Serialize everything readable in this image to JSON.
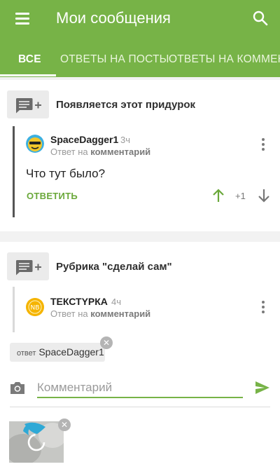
{
  "header": {
    "title": "Мои сообщения",
    "icons": {
      "menu": "hamburger-menu-icon",
      "search": "search-icon"
    }
  },
  "tabs": [
    {
      "label": "ВСЕ",
      "active": true
    },
    {
      "label": "ОТВЕТЫ НА ПОСТЫ",
      "active": false
    },
    {
      "label": "ОТВЕТЫ НА КОММЕНТАРИИ",
      "active": false
    }
  ],
  "posts": [
    {
      "title": "Появляется этот придурок",
      "comment": {
        "author": "SpaceDagger1",
        "time": "3ч",
        "reply_prefix": "Ответ на",
        "reply_target": "комментарий",
        "text": "Что тут было?",
        "reply_label": "ОТВЕТИТЬ",
        "rating": "+1"
      }
    },
    {
      "title": "Рубрика \"сделай сам\"",
      "comment": {
        "author": "ТЕКСТYРКА",
        "time": "4ч",
        "reply_prefix": "Ответ на",
        "reply_target": "комментарий",
        "avatar_text": "NB"
      }
    }
  ],
  "compose": {
    "reply_prefix": "ответ",
    "reply_to": "SpaceDagger1",
    "placeholder": "Комментарий",
    "value": ""
  },
  "colors": {
    "accent": "#77b347",
    "upvote": "#6aa83a",
    "avatar_ring": "#f5b400"
  }
}
